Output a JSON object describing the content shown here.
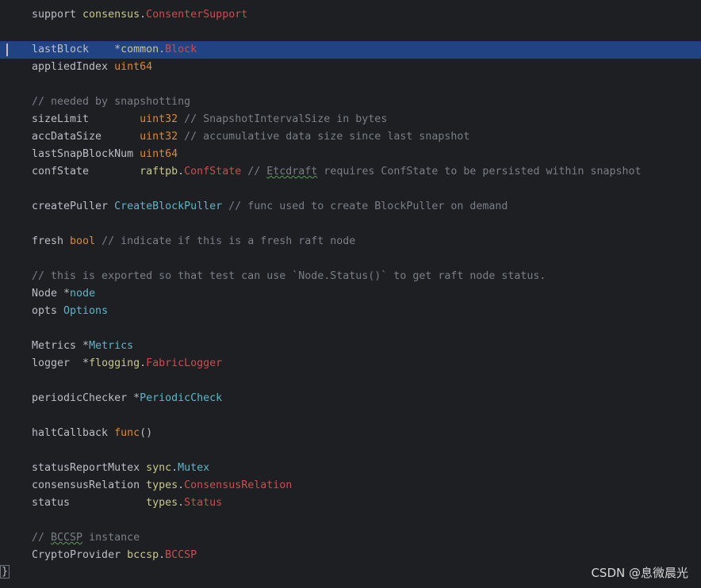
{
  "editor": {
    "lines": [
      [
        {
          "t": "support ",
          "c": "text"
        },
        {
          "t": "consensus",
          "c": "pkg"
        },
        {
          "t": ".",
          "c": "text"
        },
        {
          "t": "ConsenterSupport",
          "c": "type"
        }
      ],
      [],
      [
        {
          "t": "lastBlock    ",
          "c": "text"
        },
        {
          "t": "*",
          "c": "text"
        },
        {
          "t": "common",
          "c": "pkg"
        },
        {
          "t": ".",
          "c": "text"
        },
        {
          "t": "Block",
          "c": "type"
        }
      ],
      [
        {
          "t": "appliedIndex ",
          "c": "text"
        },
        {
          "t": "uint64",
          "c": "builtin"
        }
      ],
      [],
      [
        {
          "t": "// needed by snapshotting",
          "c": "comment"
        }
      ],
      [
        {
          "t": "sizeLimit        ",
          "c": "text"
        },
        {
          "t": "uint32",
          "c": "builtin"
        },
        {
          "t": " // SnapshotIntervalSize in bytes",
          "c": "comment"
        }
      ],
      [
        {
          "t": "accDataSize      ",
          "c": "text"
        },
        {
          "t": "uint32",
          "c": "builtin"
        },
        {
          "t": " // accumulative data size since last snapshot",
          "c": "comment"
        }
      ],
      [
        {
          "t": "lastSnapBlockNum ",
          "c": "text"
        },
        {
          "t": "uint64",
          "c": "builtin"
        }
      ],
      [
        {
          "t": "confState        ",
          "c": "text"
        },
        {
          "t": "raftpb",
          "c": "pkg"
        },
        {
          "t": ".",
          "c": "text"
        },
        {
          "t": "ConfState",
          "c": "type"
        },
        {
          "t": " // ",
          "c": "comment"
        },
        {
          "t": "Etcdraft",
          "c": "comment",
          "sq": true
        },
        {
          "t": " requires ConfState to be persisted within snapshot",
          "c": "comment"
        }
      ],
      [],
      [
        {
          "t": "createPuller ",
          "c": "text"
        },
        {
          "t": "CreateBlockPuller",
          "c": "ident"
        },
        {
          "t": " // func used to create BlockPuller on demand",
          "c": "comment"
        }
      ],
      [],
      [
        {
          "t": "fresh ",
          "c": "text"
        },
        {
          "t": "bool",
          "c": "builtin"
        },
        {
          "t": " // indicate if this is a fresh raft node",
          "c": "comment"
        }
      ],
      [],
      [
        {
          "t": "// this is exported so that test can use `Node.Status()` to get raft node status.",
          "c": "comment"
        }
      ],
      [
        {
          "t": "Node ",
          "c": "text"
        },
        {
          "t": "*",
          "c": "text"
        },
        {
          "t": "node",
          "c": "ident"
        }
      ],
      [
        {
          "t": "opts ",
          "c": "text"
        },
        {
          "t": "Options",
          "c": "ident"
        }
      ],
      [],
      [
        {
          "t": "Metrics ",
          "c": "text"
        },
        {
          "t": "*",
          "c": "text"
        },
        {
          "t": "Metrics",
          "c": "ident"
        }
      ],
      [
        {
          "t": "logger  ",
          "c": "text"
        },
        {
          "t": "*",
          "c": "text"
        },
        {
          "t": "flogging",
          "c": "pkg"
        },
        {
          "t": ".",
          "c": "text"
        },
        {
          "t": "FabricLogger",
          "c": "type"
        }
      ],
      [],
      [
        {
          "t": "periodicChecker ",
          "c": "text"
        },
        {
          "t": "*",
          "c": "text"
        },
        {
          "t": "PeriodicCheck",
          "c": "ident"
        }
      ],
      [],
      [
        {
          "t": "haltCallback ",
          "c": "text"
        },
        {
          "t": "func",
          "c": "builtin"
        },
        {
          "t": "()",
          "c": "text"
        }
      ],
      [],
      [
        {
          "t": "statusReportMutex ",
          "c": "text"
        },
        {
          "t": "sync",
          "c": "pkg"
        },
        {
          "t": ".",
          "c": "text"
        },
        {
          "t": "Mutex",
          "c": "ident"
        }
      ],
      [
        {
          "t": "consensusRelation ",
          "c": "text"
        },
        {
          "t": "types",
          "c": "pkg"
        },
        {
          "t": ".",
          "c": "text"
        },
        {
          "t": "ConsensusRelation",
          "c": "type"
        }
      ],
      [
        {
          "t": "status            ",
          "c": "text"
        },
        {
          "t": "types",
          "c": "pkg"
        },
        {
          "t": ".",
          "c": "text"
        },
        {
          "t": "Status",
          "c": "type"
        }
      ],
      [],
      [
        {
          "t": "// ",
          "c": "comment"
        },
        {
          "t": "BCCSP",
          "c": "comment",
          "sq": true
        },
        {
          "t": " instance",
          "c": "comment"
        }
      ],
      [
        {
          "t": "CryptoProvider ",
          "c": "text"
        },
        {
          "t": "bccsp",
          "c": "pkg"
        },
        {
          "t": ".",
          "c": "text"
        },
        {
          "t": "BCCSP",
          "c": "type"
        }
      ]
    ],
    "highlighted_line": 2,
    "closing_brace": "}"
  },
  "watermark": "CSDN @息微晨光",
  "colors": {
    "background": "#1e1f22",
    "highlight": "#214283",
    "text": "#bcbec4",
    "package": "#c8c88a",
    "type": "#c94f4f",
    "builtin": "#d9893b",
    "identifier": "#5fb4c7",
    "comment": "#7a7e85"
  }
}
